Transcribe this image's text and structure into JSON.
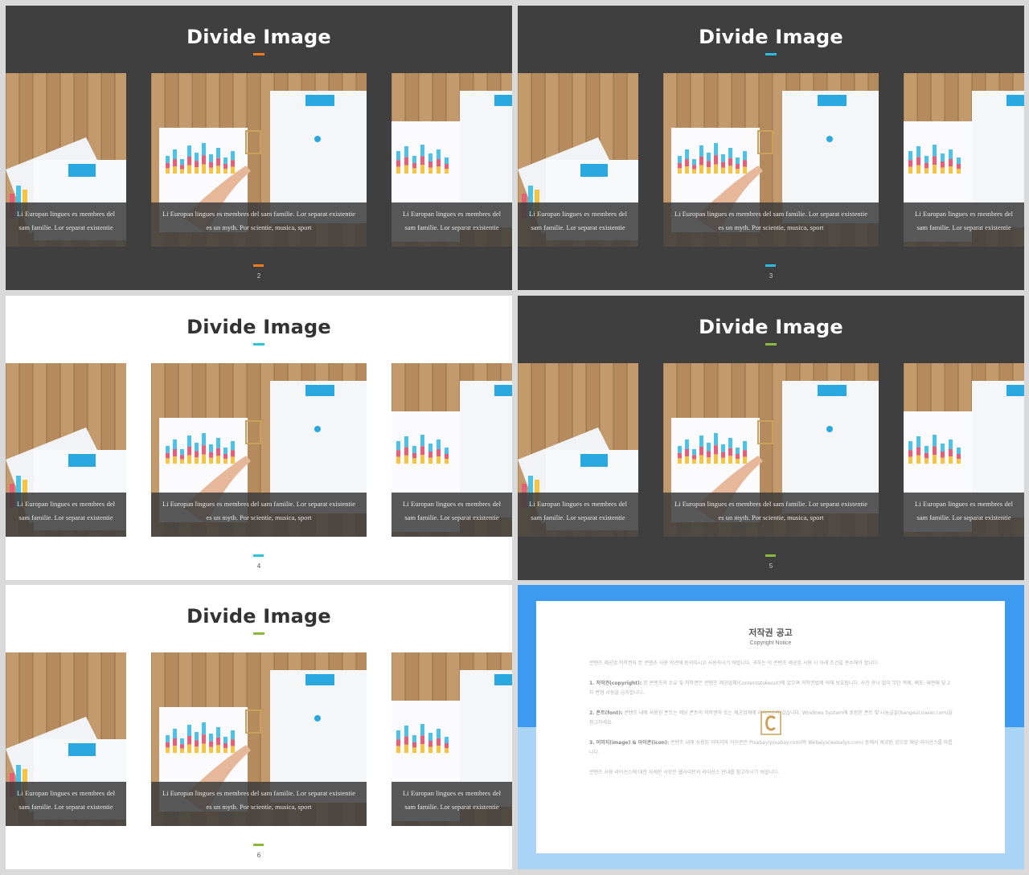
{
  "slides": [
    {
      "title": "Divide Image",
      "page": "2",
      "theme": "dark",
      "accent": "#f07a1d"
    },
    {
      "title": "Divide Image",
      "page": "3",
      "theme": "dark",
      "accent": "#2bbbe0"
    },
    {
      "title": "Divide Image",
      "page": "4",
      "theme": "light",
      "accent": "#2bc4dc"
    },
    {
      "title": "Divide Image",
      "page": "5",
      "theme": "dark",
      "accent": "#8cb83c"
    },
    {
      "title": "Divide Image",
      "page": "6",
      "theme": "light",
      "accent": "#8cb83c"
    }
  ],
  "captions": {
    "side": "Li Europan lingues es membres del sam familie. Lor separat existentie",
    "center": "Li Europan lingues es membres del sam familie. Lor separat existentie es un myth. Por scientie, musica, sport"
  },
  "notice": {
    "title": "저작권 공고",
    "subtitle": "Copyright Notice",
    "intro": "콘텐츠 제공업 저작권자 본 콘텐츠 사용 약관에 동의하시고 사용하시기 바랍니다. 귀하는 이 콘텐츠 제공업 사용 시 아래 조건을 준수해야 합니다.",
    "item1_head": "1. 저작권(copyright):",
    "item1_body": "본 콘텐츠의 소유 및 저작권은 콘텐츠 제공업체(Contentstokeout)에 있으며 저작권법에 의해 보호됩니다. 사전 승낙 없이 무단 복제, 배포, 재판매 및 2차 변형 사용을 금지합니다.",
    "item2_head": "2. 폰트(font):",
    "item2_body": "콘텐츠 내에 사용된 폰트는 해당 폰트의 저작권자 또는 제공업체에 라이선스가 있습니다. Windows System에 포함된 폰트 및 나눔글꼴(hangeul.naver.com)을 참고하세요.",
    "item3_head": "3. 이미지(image) & 아이콘(icon):",
    "item3_body": "콘텐츠 내에 사용된 이미지와 아이콘은 Pixabay(pixabay.com)와 Webalys(webalys.com) 등에서 제공된 것으로 해당 라이선스를 따릅니다.",
    "outro": "콘텐츠 사용 라이선스에 대한 자세한 사항은 웹사이트의 라이선스 안내를 참고하시기 바랍니다."
  }
}
